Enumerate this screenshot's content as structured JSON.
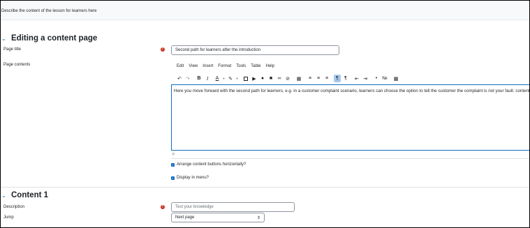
{
  "top_description": "Describe the content of the lesson for learners here",
  "section1": {
    "title": "Editing a content page"
  },
  "page_title": {
    "label": "Page title",
    "value": "Second path for learners after the introduction"
  },
  "page_contents": {
    "label": "Page contents"
  },
  "editor": {
    "menus": [
      "Edit",
      "View",
      "Insert",
      "Format",
      "Tools",
      "Table",
      "Help"
    ],
    "text": "Here you move forward with the second path for learners, e.g. in a customer complaint scenario, learners can choose the option to tell the customer the complaint is not your fault. content.",
    "status": "p"
  },
  "options": {
    "arrange_label": "Arrange content buttons horizontally?",
    "display_label": "Display in menu?"
  },
  "section2": {
    "title": "Content 1"
  },
  "description": {
    "label": "Description",
    "placeholder": "Test your knowledge"
  },
  "jump": {
    "label": "Jump",
    "value": "Next page"
  },
  "colors": {
    "accent": "#0f6cbf",
    "required": "#ca3120"
  }
}
